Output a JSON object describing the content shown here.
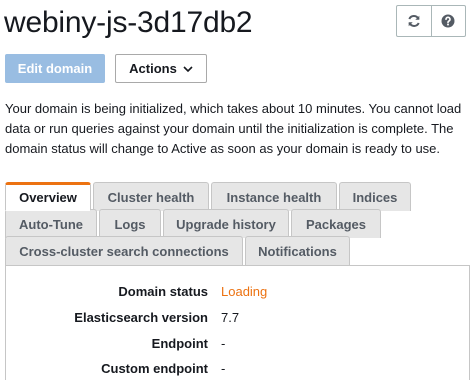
{
  "header": {
    "title": "webiny-js-3d17db2",
    "refresh_icon": "refresh-icon",
    "help_icon": "help-icon"
  },
  "toolbar": {
    "edit_label": "Edit domain",
    "actions_label": "Actions",
    "actions_icon": "chevron-down-icon"
  },
  "message": "Your domain is being initialized, which takes about 10 minutes. You cannot load data or run queries against your domain until the initialization is complete. The domain status will change to Active as soon as your domain is ready to use.",
  "tabs": [
    {
      "label": "Overview",
      "active": true
    },
    {
      "label": "Cluster health",
      "active": false
    },
    {
      "label": "Instance health",
      "active": false
    },
    {
      "label": "Indices",
      "active": false
    },
    {
      "label": "Auto-Tune",
      "active": false
    },
    {
      "label": "Logs",
      "active": false
    },
    {
      "label": "Upgrade history",
      "active": false
    },
    {
      "label": "Packages",
      "active": false
    },
    {
      "label": "Cross-cluster search connections",
      "active": false
    },
    {
      "label": "Notifications",
      "active": false
    }
  ],
  "overview": {
    "rows": [
      {
        "label": "Domain status",
        "value": "Loading"
      },
      {
        "label": "Elasticsearch version",
        "value": "7.7"
      },
      {
        "label": "Endpoint",
        "value": "-"
      },
      {
        "label": "Custom endpoint",
        "value": "-"
      }
    ]
  },
  "colors": {
    "accent": "#ec7211",
    "primary_disabled": "#99bde2",
    "tab_bg": "#e6e6e6",
    "border": "#c6c6c6"
  }
}
